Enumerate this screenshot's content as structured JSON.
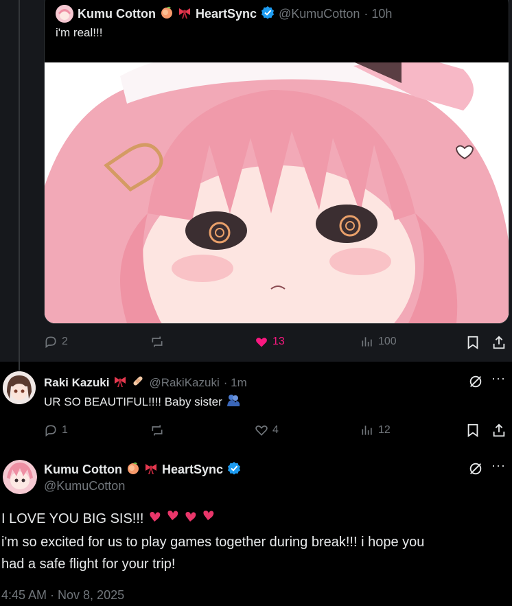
{
  "quote": {
    "author_name": "Kumu Cotton",
    "author_suffix": "HeartSync",
    "handle": "@KumuCotton",
    "time": "· 10h",
    "text": "i'm real!!!",
    "actions": {
      "replies": "2",
      "likes": "13",
      "views": "100"
    }
  },
  "reply": {
    "author_name": "Raki Kazuki",
    "handle": "@RakiKazuki",
    "time": "· 1m",
    "text": "UR SO BEAUTIFUL!!!! Baby sister",
    "actions": {
      "replies": "1",
      "likes": "4",
      "views": "12"
    }
  },
  "main": {
    "author_name": "Kumu Cotton",
    "author_suffix": "HeartSync",
    "handle": "@KumuCotton",
    "line1": "I LOVE YOU BIG SIS!!!",
    "line2": "i'm so excited for us to play games together during break!!! i hope you",
    "line3": "had a safe flight for your trip!",
    "timestamp": "4:45 AM · Nov 8, 2025"
  },
  "colors": {
    "background": "#000000",
    "muted": "#71767b",
    "like_pink": "#f91880",
    "verified_blue": "#1d9bf0"
  },
  "icons": [
    "reply-icon",
    "retweet-icon",
    "heart-icon",
    "views-icon",
    "bookmark-icon",
    "share-icon",
    "grok-icon",
    "more-icon",
    "verified-icon",
    "peach-emoji",
    "ribbon-emoji",
    "bandage-emoji",
    "hearts-emoji",
    "hug-emoji"
  ]
}
